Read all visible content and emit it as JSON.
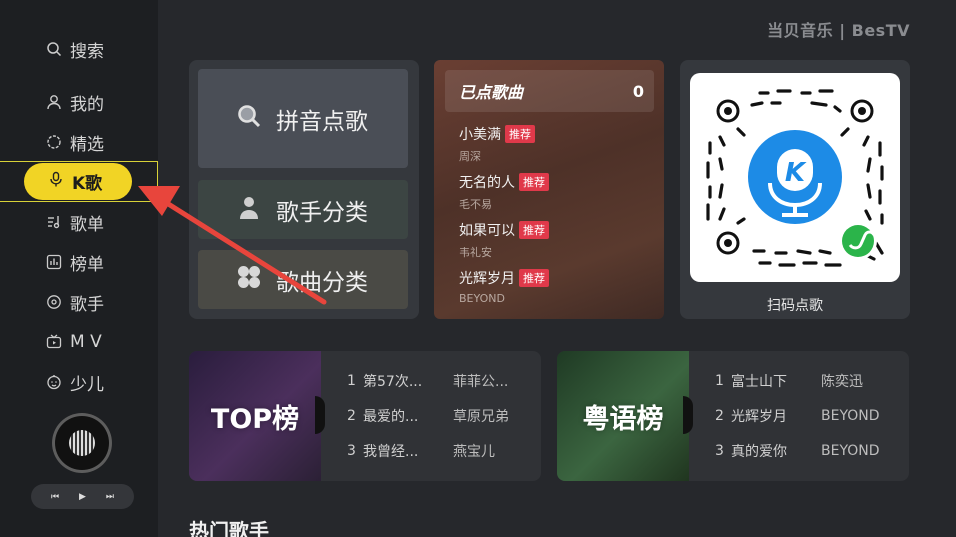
{
  "brand": "当贝音乐 | BesTV",
  "sidebar": {
    "items": [
      {
        "label": "搜索",
        "icon": "search-icon"
      },
      {
        "label": "我的",
        "icon": "user-icon"
      },
      {
        "label": "精选",
        "icon": "circle-icon"
      },
      {
        "label": "K歌",
        "icon": "microphone-icon"
      },
      {
        "label": "歌单",
        "icon": "music-list-icon"
      },
      {
        "label": "榜单",
        "icon": "chart-icon"
      },
      {
        "label": "歌手",
        "icon": "singer-icon"
      },
      {
        "label": "M V",
        "icon": "tv-icon"
      },
      {
        "label": "少儿",
        "icon": "child-face-icon"
      }
    ],
    "active_index": 3,
    "active_color": "#f1d425",
    "player": {
      "prev": "⏮",
      "play": "▶",
      "next": "⏭"
    }
  },
  "search_panel": {
    "buttons": [
      {
        "label": "拼音点歌",
        "icon": "search-icon"
      },
      {
        "label": "歌手分类",
        "icon": "singer-icon"
      },
      {
        "label": "歌曲分类",
        "icon": "grid-icon"
      }
    ]
  },
  "queue": {
    "title": "已点歌曲",
    "count": "0",
    "items": [
      {
        "title": "小美满",
        "tag": "推荐",
        "artist": "周深"
      },
      {
        "title": "无名的人",
        "tag": "推荐",
        "artist": "毛不易"
      },
      {
        "title": "如果可以",
        "tag": "推荐",
        "artist": "韦礼安"
      },
      {
        "title": "光辉岁月",
        "tag": "推荐",
        "artist": "BEYOND"
      }
    ]
  },
  "qr": {
    "label": "扫码点歌",
    "logo_letter": "K"
  },
  "charts": [
    {
      "title": "TOP榜",
      "rows": [
        {
          "num": "1",
          "song": "第57次...",
          "singer": "菲菲公..."
        },
        {
          "num": "2",
          "song": "最爱的...",
          "singer": "草原兄弟"
        },
        {
          "num": "3",
          "song": "我曾经...",
          "singer": "燕宝儿"
        }
      ]
    },
    {
      "title": "粤语榜",
      "rows": [
        {
          "num": "1",
          "song": "富士山下",
          "singer": "陈奕迅"
        },
        {
          "num": "2",
          "song": "光辉岁月",
          "singer": "BEYOND"
        },
        {
          "num": "3",
          "song": "真的爱你",
          "singer": "BEYOND"
        }
      ]
    }
  ],
  "section_title": "热门歌手",
  "accent_red": "#e8453c"
}
